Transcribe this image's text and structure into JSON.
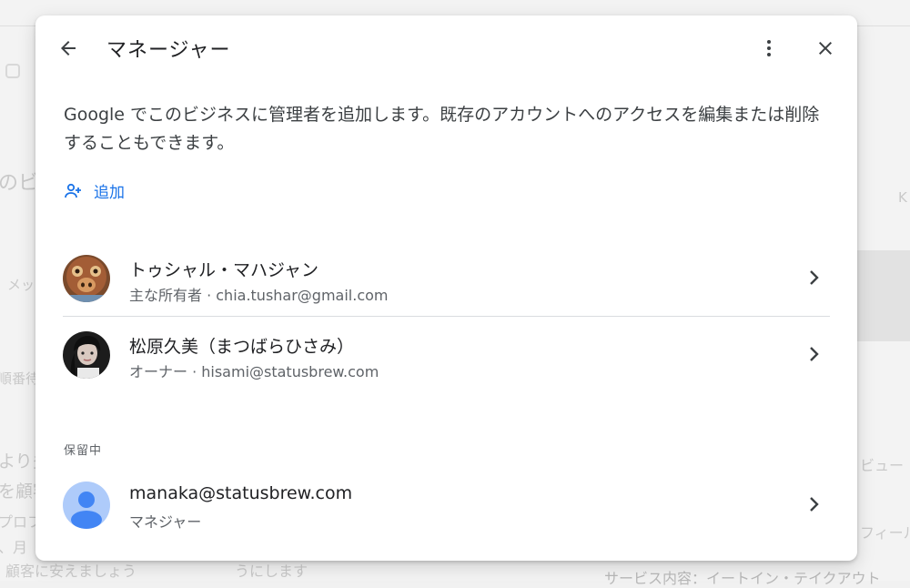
{
  "background": {
    "fragments": [
      "のビ",
      "メッ",
      "順番待",
      "より多",
      "を顧客",
      "プロフ",
      "、月",
      "顧客に安えましょう",
      "うにします",
      "ビュー",
      "フィール",
      "サービス内容：イートイン・テイクアウト",
      "K"
    ]
  },
  "dialog": {
    "title": "マネージャー",
    "description": "Google でこのビジネスに管理者を追加します。既存のアカウントへのアクセスを編集または削除することもできます。",
    "add_label": "追加",
    "pending_label": "保留中",
    "managers": [
      {
        "name": "トゥシャル・マハジャン",
        "detail": "主な所有者 · chia.tushar@gmail.com"
      },
      {
        "name": "松原久美（まつばらひさみ）",
        "detail": "オーナー · hisami@statusbrew.com"
      }
    ],
    "pending": [
      {
        "name": "manaka@statusbrew.com",
        "detail": "マネジャー"
      }
    ]
  },
  "icons": {
    "back": "arrow-back-icon",
    "more": "more-vert-icon",
    "close": "close-icon",
    "add_person": "person-add-icon",
    "chevron": "chevron-right-icon",
    "default_avatar": "person-icon"
  },
  "colors": {
    "accent": "#1a73e8",
    "avatar_default_bg": "#aecbfa",
    "avatar_default_fg": "#4285f4"
  }
}
